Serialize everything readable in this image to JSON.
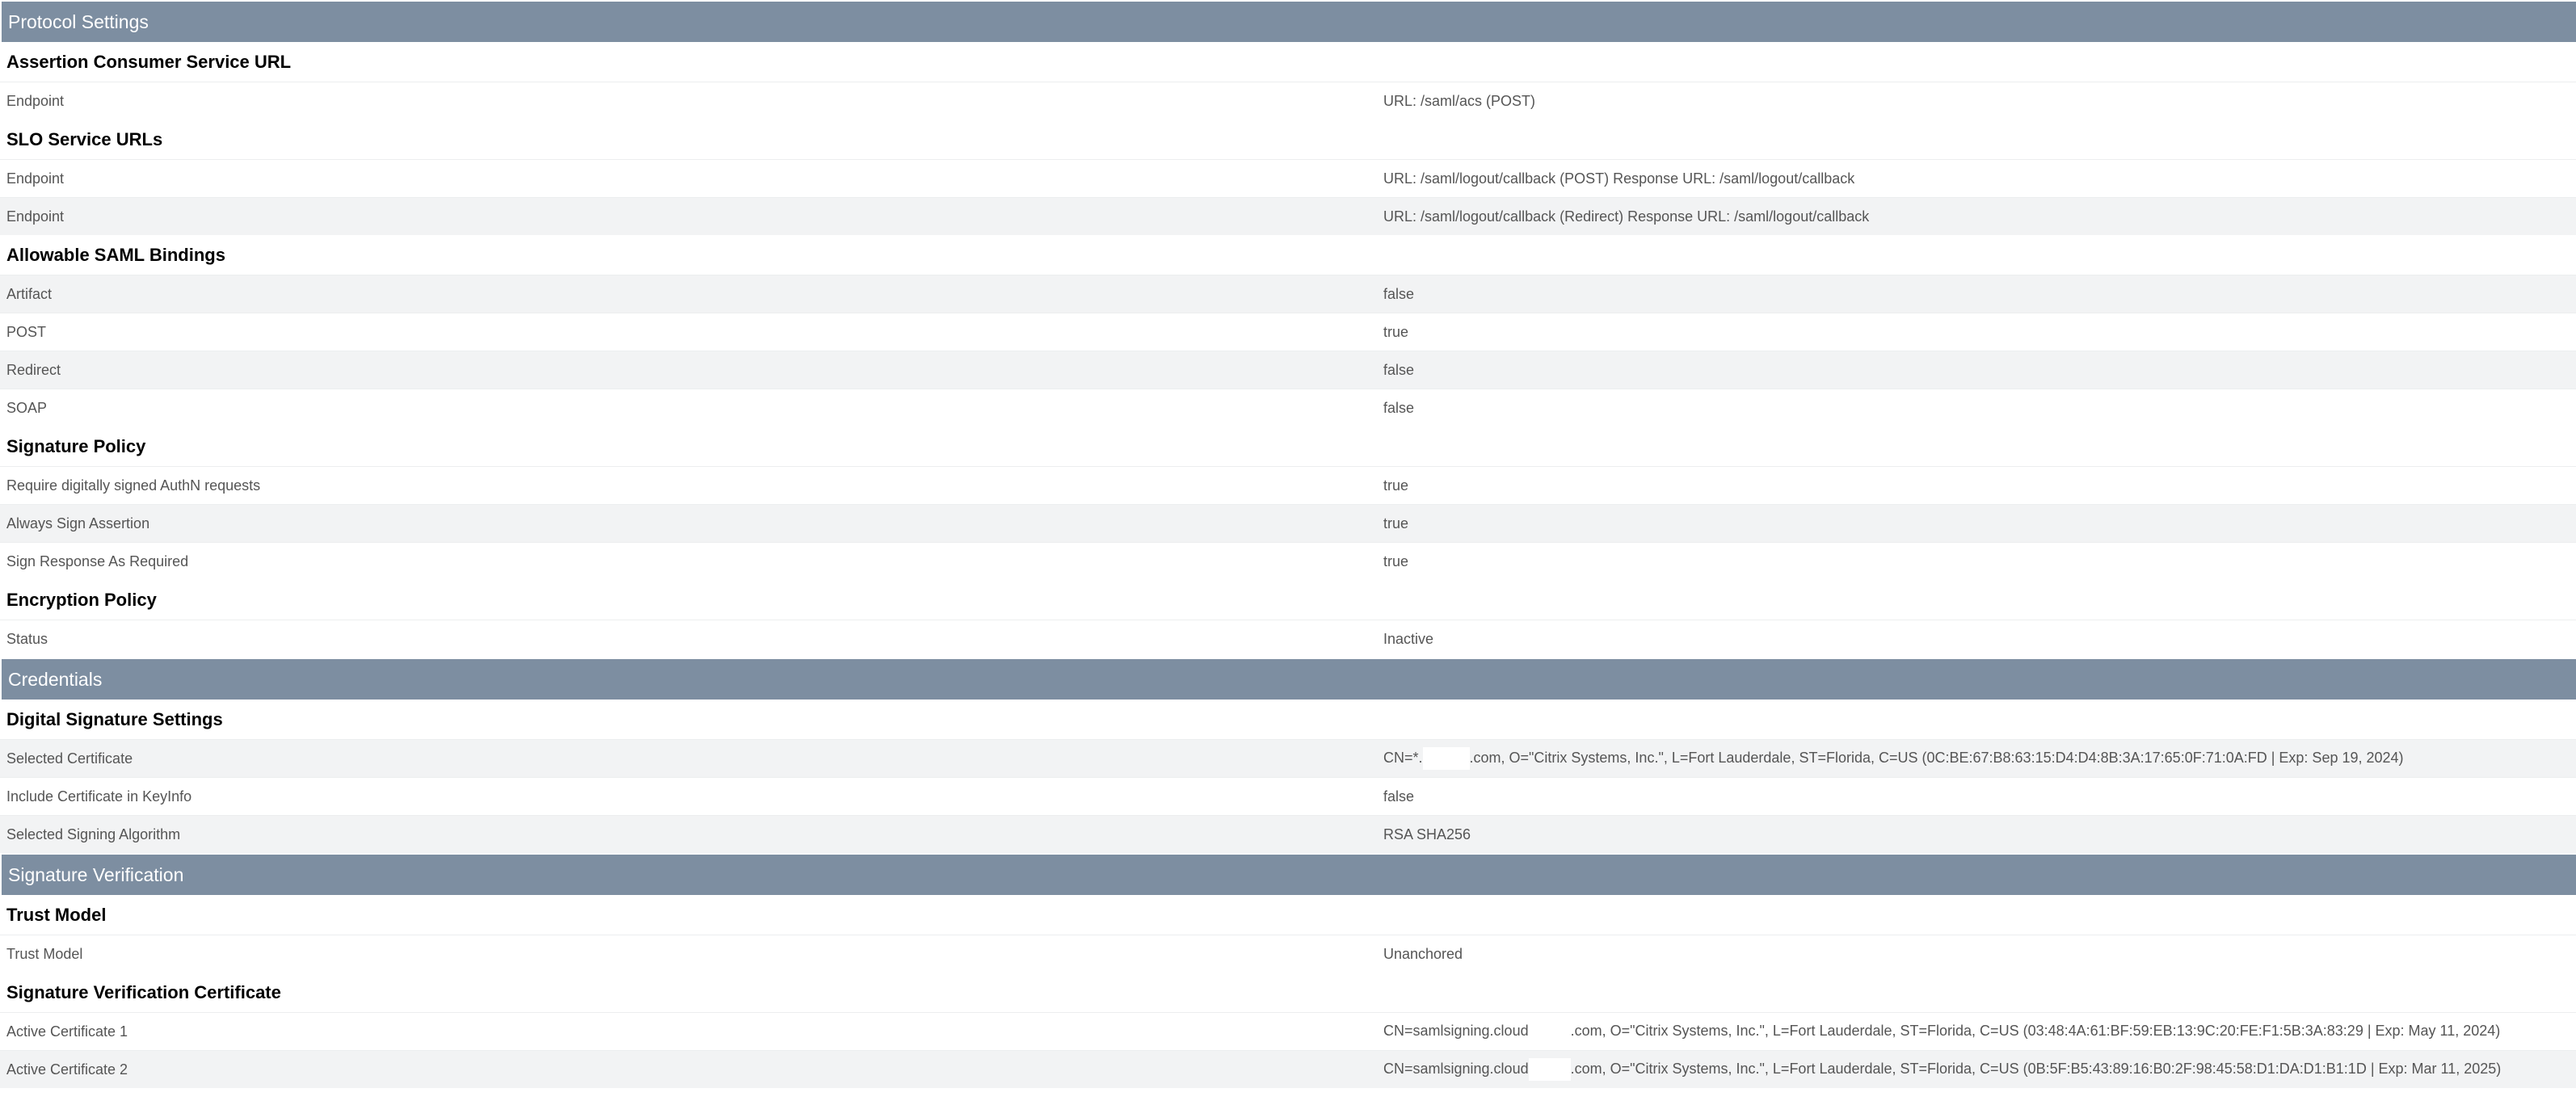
{
  "protocol_settings": {
    "header": "Protocol Settings",
    "acs": {
      "heading": "Assertion Consumer Service URL",
      "rows": [
        {
          "label": "Endpoint",
          "value": "URL: /saml/acs (POST)"
        }
      ]
    },
    "slo": {
      "heading": "SLO Service URLs",
      "rows": [
        {
          "label": "Endpoint",
          "value": "URL: /saml/logout/callback (POST) Response URL: /saml/logout/callback"
        },
        {
          "label": "Endpoint",
          "value": "URL: /saml/logout/callback (Redirect) Response URL: /saml/logout/callback"
        }
      ]
    },
    "bindings": {
      "heading": "Allowable SAML Bindings",
      "rows": [
        {
          "label": "Artifact",
          "value": "false"
        },
        {
          "label": "POST",
          "value": "true"
        },
        {
          "label": "Redirect",
          "value": "false"
        },
        {
          "label": "SOAP",
          "value": "false"
        }
      ]
    },
    "signature_policy": {
      "heading": "Signature Policy",
      "rows": [
        {
          "label": "Require digitally signed AuthN requests",
          "value": "true"
        },
        {
          "label": "Always Sign Assertion",
          "value": "true"
        },
        {
          "label": "Sign Response As Required",
          "value": "true"
        }
      ]
    },
    "encryption_policy": {
      "heading": "Encryption Policy",
      "rows": [
        {
          "label": "Status",
          "value": "Inactive"
        }
      ]
    }
  },
  "credentials": {
    "header": "Credentials",
    "digital_signature": {
      "heading": "Digital Signature Settings",
      "selected_certificate": {
        "label": "Selected Certificate",
        "value_prefix": "CN=*.",
        "value_suffix": ".com, O=\"Citrix Systems, Inc.\", L=Fort Lauderdale, ST=Florida, C=US (0C:BE:67:B8:63:15:D4:D4:8B:3A:17:65:0F:71:0A:FD | Exp: Sep 19, 2024)"
      },
      "rows": [
        {
          "label": "Include Certificate in KeyInfo",
          "value": "false"
        },
        {
          "label": "Selected Signing Algorithm",
          "value": "RSA SHA256"
        }
      ]
    }
  },
  "signature_verification": {
    "header": "Signature Verification",
    "trust_model": {
      "heading": "Trust Model",
      "rows": [
        {
          "label": "Trust Model",
          "value": "Unanchored"
        }
      ]
    },
    "verification_certificate": {
      "heading": "Signature Verification Certificate",
      "rows": [
        {
          "label": "Active Certificate 1",
          "value_prefix": "CN=samlsigning.cloud",
          "value_suffix": ".com, O=\"Citrix Systems, Inc.\", L=Fort Lauderdale, ST=Florida, C=US (03:48:4A:61:BF:59:EB:13:9C:20:FE:F1:5B:3A:83:29 | Exp: May 11, 2024)"
        },
        {
          "label": "Active Certificate 2",
          "value_prefix": "CN=samlsigning.cloud",
          "value_suffix": ".com, O=\"Citrix Systems, Inc.\", L=Fort Lauderdale, ST=Florida, C=US (0B:5F:B5:43:89:16:B0:2F:98:45:58:D1:DA:D1:B1:1D | Exp: Mar 11, 2025)"
        }
      ]
    }
  }
}
